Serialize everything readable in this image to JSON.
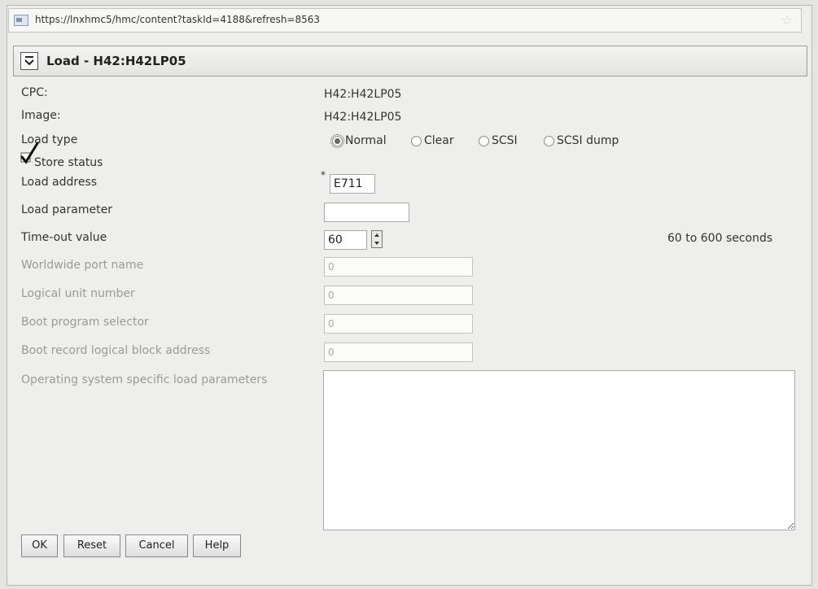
{
  "browser": {
    "url": "https://lnxhmc5/hmc/content?taskId=4188&refresh=8563"
  },
  "header": {
    "title": "Load - H42:H42LP05"
  },
  "form": {
    "cpc_label": "CPC:",
    "cpc_value": "H42:H42LP05",
    "image_label": "Image:",
    "image_value": "H42:H42LP05",
    "load_type_label": "Load type",
    "load_type_options": [
      {
        "label": "Normal",
        "selected": true
      },
      {
        "label": "Clear",
        "selected": false
      },
      {
        "label": "SCSI",
        "selected": false
      },
      {
        "label": "SCSI dump",
        "selected": false
      }
    ],
    "store_status_label": "Store status",
    "store_status_checked": true,
    "load_address_label": "Load address",
    "load_address_required_marker": "*",
    "load_address_value": "E711",
    "load_parameter_label": "Load parameter",
    "load_parameter_value": "",
    "timeout_label": "Time-out value",
    "timeout_value": "60",
    "timeout_range": "60 to 600 seconds",
    "wwpn_label": "Worldwide port name",
    "wwpn_value": "0",
    "lun_label": "Logical unit number",
    "lun_value": "0",
    "boot_program_label": "Boot program selector",
    "boot_program_value": "0",
    "boot_record_label": "Boot record logical block address",
    "boot_record_value": "0",
    "os_params_label": "Operating system specific load parameters",
    "os_params_value": ""
  },
  "buttons": {
    "ok": "OK",
    "reset": "Reset",
    "cancel": "Cancel",
    "help": "Help"
  }
}
